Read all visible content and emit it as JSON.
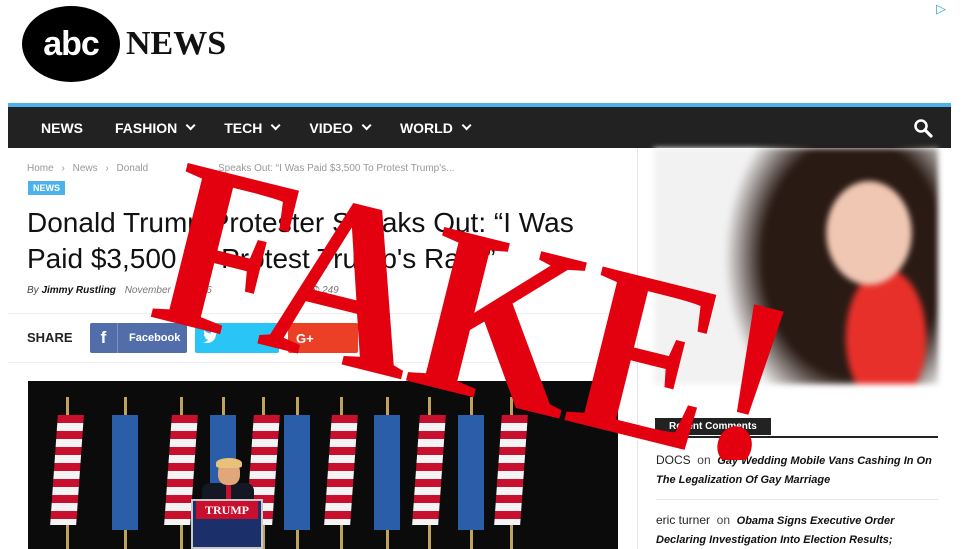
{
  "logo": {
    "abc": "abc",
    "news": "NEWS"
  },
  "nav": {
    "items": [
      {
        "label": "NEWS",
        "dropdown": false
      },
      {
        "label": "FASHION",
        "dropdown": true
      },
      {
        "label": "TECH",
        "dropdown": true
      },
      {
        "label": "VIDEO",
        "dropdown": true
      },
      {
        "label": "WORLD",
        "dropdown": true
      }
    ]
  },
  "breadcrumb": [
    "Home",
    "›",
    "News",
    "›",
    "Donald",
    "Speaks Out: “I Was Paid $3,500 To Protest Trump's..."
  ],
  "article": {
    "category": "NEWS",
    "title_line1": "Donald Trump Protester Speaks Out: “I Was",
    "title_line2": "Paid $3,500 To Protest Trump's Rally”",
    "by": "By",
    "author": "Jimmy Rustling",
    "date": "November 11, 2016",
    "views": "249"
  },
  "share": {
    "label": "SHARE",
    "facebook": "Facebook",
    "facebook_icon": "f",
    "google_icon": "G+"
  },
  "photo": {
    "podium_sign": "TRUMP"
  },
  "sidebar": {
    "widget_title": "Recent Comments",
    "comments": [
      {
        "author": "DOCS",
        "on": "on",
        "title": "Gay Wedding Mobile Vans Cashing In On The Legalization Of Gay Marriage"
      },
      {
        "author": "eric turner",
        "on": "on",
        "title": "Obama Signs Executive Order Declaring Investigation Into Election Results;"
      }
    ]
  },
  "overlay": {
    "stamp_text": "FAKE!",
    "color": "#e3000f"
  },
  "colors": {
    "accent": "#4db2ec",
    "nav_bg": "#222222",
    "facebook": "#516eab",
    "twitter": "#29c5f6",
    "google": "#eb4026"
  }
}
